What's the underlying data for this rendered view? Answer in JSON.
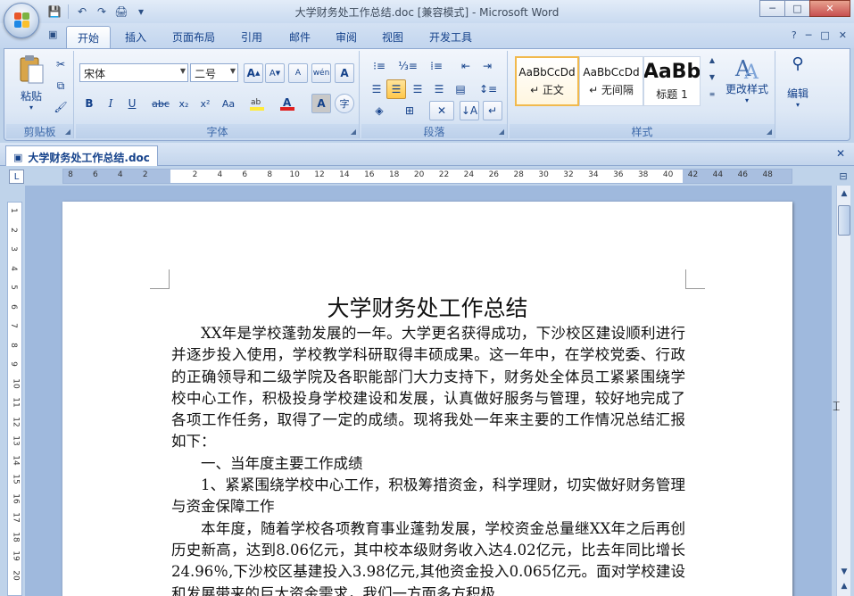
{
  "window": {
    "title": "大学财务处工作总结.doc [兼容模式] - Microsoft Word",
    "minimize": "─",
    "maximize": "□",
    "close": "✕"
  },
  "qat": {
    "save": "💾",
    "undo": "↶",
    "redo": "↷",
    "print": "🖨",
    "more": "▾"
  },
  "tabs": [
    {
      "label": "开始",
      "active": true
    },
    {
      "label": "插入"
    },
    {
      "label": "页面布局"
    },
    {
      "label": "引用"
    },
    {
      "label": "邮件"
    },
    {
      "label": "审阅"
    },
    {
      "label": "视图"
    },
    {
      "label": "开发工具"
    }
  ],
  "ribbon_right": {
    "help": "?",
    "min": "─",
    "restore": "□",
    "close": "✕"
  },
  "clipboard": {
    "label": "剪贴板",
    "paste": "粘贴"
  },
  "font": {
    "label": "字体",
    "name": "宋体",
    "size": "二号",
    "bold": "B",
    "italic": "I",
    "underline": "U",
    "strike": "abc",
    "sub": "x₂",
    "sup": "x²",
    "case": "Aa",
    "grow": "A",
    "shrink": "A",
    "clear": "A",
    "pinyin": "wén",
    "border": "A",
    "shade": "A",
    "enclose": "字"
  },
  "paragraph": {
    "label": "段落"
  },
  "styles": {
    "label": "样式",
    "items": [
      {
        "sample": "AaBbCcDd",
        "name": "↵ 正文",
        "selected": true
      },
      {
        "sample": "AaBbCcDd",
        "name": "↵ 无间隔"
      },
      {
        "sample": "AaBb",
        "name": "标题 1"
      }
    ],
    "change": "更改样式"
  },
  "editing": {
    "label": "编辑"
  },
  "document": {
    "tab_name": "大学财务处工作总结.doc",
    "title": "大学财务处工作总结",
    "paragraphs": [
      {
        "text": "XX年是学校蓬勃发展的一年。大学更名获得成功，下沙校区建设顺利进行并逐步投入使用，学校教学科研取得丰硕成果。这一年中，在学校党委、行政的正确领导和二级学院及各职能部门大力支持下，财务处全体员工紧紧围绕学校中心工作，积极投身学校建设和发展，认真做好服务与管理，较好地完成了各项工作任务，取得了一定的成绩。现将我处一年来主要的工作情况总结汇报如下：",
        "indent": true
      },
      {
        "text": "一、当年度主要工作成绩",
        "indent": true
      },
      {
        "text": "1、紧紧围绕学校中心工作，积极筹措资金，科学理财，切实做好财务管理与资金保障工作",
        "indent": true
      },
      {
        "text": "本年度，随着学校各项教育事业蓬勃发展，学校资金总量继XX年之后再创历史新高，达到8.06亿元，其中校本级财务收入达4.02亿元，比去年同比增长24.96％,下沙校区基建投入3.98亿元,其他资金投入0.065亿元。面对学校建设和发展带来的巨大资金需求，我们一方面多方积极",
        "indent": true
      }
    ]
  },
  "ruler": {
    "h_numbers": [
      "8",
      "6",
      "4",
      "2",
      "",
      "2",
      "4",
      "6",
      "8",
      "10",
      "12",
      "14",
      "16",
      "18",
      "20",
      "22",
      "24",
      "26",
      "28",
      "30",
      "32",
      "34",
      "36",
      "38",
      "40",
      "42",
      "44",
      "46",
      "48"
    ],
    "v_numbers": [
      "1",
      "2",
      "3",
      "4",
      "5",
      "6",
      "7",
      "8",
      "9",
      "10",
      "11",
      "12",
      "13",
      "14",
      "15",
      "16",
      "17",
      "18",
      "19",
      "20"
    ]
  }
}
